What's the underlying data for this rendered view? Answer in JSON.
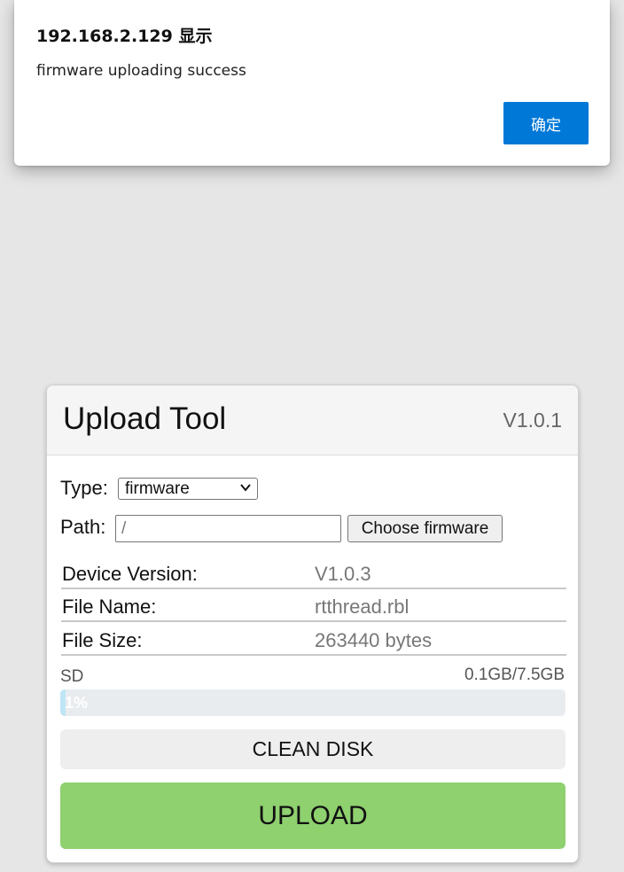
{
  "alert": {
    "title": "192.168.2.129 显示",
    "message": "firmware uploading success",
    "ok_label": "确定",
    "ok_color": "#0078d7"
  },
  "card": {
    "title": "Upload Tool",
    "version": "V1.0.1",
    "type_label": "Type:",
    "type_value": "firmware",
    "path_label": "Path:",
    "path_value": "/",
    "choose_label": "Choose firmware",
    "info": [
      {
        "key": "Device Version:",
        "value": "V1.0.3"
      },
      {
        "key": "File Name:",
        "value": "rtthread.rbl"
      },
      {
        "key": "File Size:",
        "value": "263440 bytes"
      }
    ],
    "sd_label": "SD",
    "sd_usage": "0.1GB/7.5GB",
    "progress_text": "1%",
    "progress_value": 0.01,
    "clean_label": "CLEAN DISK",
    "upload_label": "UPLOAD",
    "upload_color": "#8fd06f"
  },
  "icons": {
    "type_dropdown": "chevron-down-icon"
  }
}
